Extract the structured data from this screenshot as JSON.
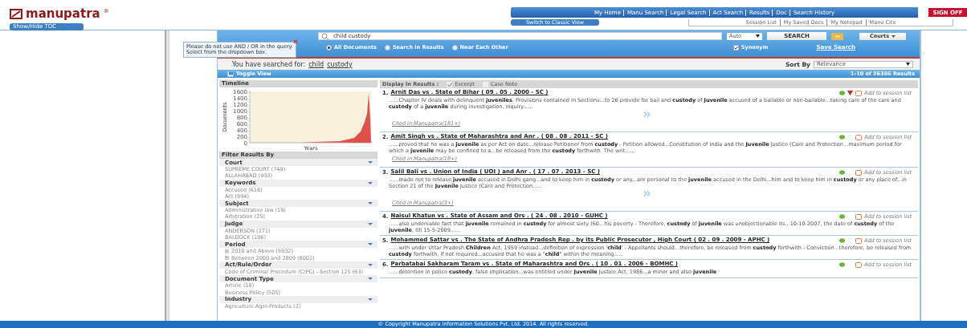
{
  "logo": {
    "text": "manupatra",
    "mark": "®"
  },
  "toc_button": "Show/Hide TOC",
  "nav": [
    "My Home",
    "Manu Search",
    "Legal Search",
    "Act Search",
    "Results",
    "Doc",
    "Search History"
  ],
  "sign_off": "SIGN OFF",
  "classic_view": "Switch to Classic View",
  "user_links": [
    "Session List",
    "My Saved Docs",
    "My Notepad",
    "Manu Cite"
  ],
  "tooltip": "Please do not use AND / OR in the query. Select from the dropdown box.",
  "search": {
    "value": "child custody",
    "mode": "Auto",
    "button": "SEARCH",
    "courts": "Courts"
  },
  "scopes": [
    {
      "label": "All Documents",
      "selected": true
    },
    {
      "label": "Search in Results",
      "selected": false
    },
    {
      "label": "Near Each Other",
      "selected": false
    }
  ],
  "synonym": {
    "label": "Synonym",
    "checked": true
  },
  "save_search": "Save Search",
  "searched": {
    "label": "You have searched for:",
    "terms": [
      "child",
      "custody"
    ]
  },
  "sort": {
    "label": "Sort By",
    "value": "Relevance"
  },
  "toggle_view": "Toggle View",
  "result_count": "1-10 of 26386 Results",
  "timeline": {
    "title": "Timeline",
    "ylabel": "Documents",
    "xlabel": "Years",
    "yticks": [
      "1600",
      "1400",
      "1200",
      "1000",
      "800",
      "600",
      "400",
      "200",
      "0"
    ]
  },
  "filters": {
    "title": "Filter Results By",
    "groups": [
      {
        "name": "Court",
        "items": [
          {
            "label": "SUPREME COURT (749)",
            "kind": "plain"
          },
          {
            "label": "ALLAHABAD (933)",
            "kind": "plain"
          }
        ]
      },
      {
        "name": "Keywords",
        "items": [
          {
            "label": "Accused (616)",
            "kind": "plain"
          },
          {
            "label": "Act (994)",
            "kind": "plain"
          }
        ]
      },
      {
        "name": "Subject",
        "items": [
          {
            "label": "Administrative law (19)",
            "kind": "plain"
          },
          {
            "label": "Arbitration (25)",
            "kind": "plain"
          }
        ]
      },
      {
        "name": "Judge",
        "items": [
          {
            "label": "ANDERSON (271)",
            "kind": "plain"
          },
          {
            "label": "BALDOCK (106)",
            "kind": "plain"
          }
        ]
      },
      {
        "name": "Period",
        "items": [
          {
            "label": "2010 and Above (5932)",
            "kind": "expandable"
          },
          {
            "label": "Between 2000 and 2009 (8002)",
            "kind": "expandable"
          }
        ]
      },
      {
        "name": "Act/Rule/Order",
        "items": [
          {
            "label": "Code of Criminal Procedure (CrPC) - Section 125 (63)",
            "kind": "plain"
          }
        ]
      },
      {
        "name": "Document Type",
        "items": [
          {
            "label": "Article (18)",
            "kind": "plain"
          },
          {
            "label": "Business Policy (505)",
            "kind": "plain"
          }
        ]
      },
      {
        "name": "Industry",
        "items": [
          {
            "label": "Agriculture Agro Products (2)",
            "kind": "plain"
          }
        ]
      }
    ]
  },
  "display": {
    "label": "Display in Results :",
    "options": [
      {
        "label": "Excerpt",
        "checked": true
      },
      {
        "label": "Case Note",
        "checked": false
      }
    ]
  },
  "results": [
    {
      "number": "1.",
      "title": "Arnit Das vs . State of Bihar ( 09 . 05 . 2000 - SC )",
      "flagged": true,
      "session": "Add to session list",
      "excerpt": "......Chapter IV deals with delinquent **juveniles**. Provisions contained In Sections...to 26 provide for bail and **custody** of **Juvenile** accused of a bailable or non-bailable...taking care of the care and **custody** of a **juvenile** during investigation, inquiry......",
      "more": true,
      "cited": "Cited in Manupatra(181+)"
    },
    {
      "number": "2.",
      "title": "Amit Singh vs . State of Maharashtra and Anr . ( 08 . 08 . 2011 - SC )",
      "flagged": false,
      "session": "Add to session list",
      "excerpt": "......proved that he was a **juvenile** as per Act on date...release Petitioner from **custody** - Petition allowed...Constitution of India and the **Juvenile** Justice (Care and Protection...maximum period for which a **juvenile** may be confined to a...be released from the **custody** forthwith. The writ......",
      "more": false,
      "cited": "Cited in Manupatra(18+)"
    },
    {
      "number": "3.",
      "title": "Salil Bali vs . Union of India ( UOI ) and Anr . ( 17 . 07 . 2013 - SC )",
      "flagged": false,
      "session": "Add to session list",
      "excerpt": "......made not to release **juvenile** accused in Delhi gang...and to keep him in **custody** or any...are personal to the **juvenile** accused in the Delhi...him and to keep him in **custody** or any place of...in Section 21 of the **Juvenile** Justice (Care and Protection......",
      "more": true,
      "cited": "Cited in Manupatra(3+)"
    },
    {
      "number": "4.",
      "title": "Naisul Khatun vs . State of Assam and Ors . ( 24 . 08 . 2010 - GUHC )",
      "flagged": false,
      "session": "Add to session list",
      "excerpt": "......also undeniable fact that **juvenile** remained in **custody** for almost sixty (60...his poverty - Therefore, **custody** of **juvenile** was unobjectionable its...10-10-2007, the date of **custody** of the **juvenile**, till 15-5-2009......",
      "more": false
    },
    {
      "number": "5.",
      "title": "Mohammed Sattar vs . The State of Andhra Pradesh Rep . by its Public Prosecutor , High Court ( 02 . 09 . 2009 - APHC )",
      "flagged": false,
      "session": "Add to session list",
      "excerpt": "......with under Uttar Pradesh **Children** Act, 1959 instead...definition of expression '**child**' - Appellants should...therefore, be released from **custody** forthwith - Conviction...therefore, be released from **custody** forthwith, if not required...accused that he was a \"**child**\" within the meaning......",
      "more": false
    },
    {
      "number": "6.",
      "title": "Parbatabai Sakharam Taram vs . State of Maharashtra and Ors . ( 10 . 01 . 2006 - BOMHC )",
      "flagged": false,
      "session": "Add to session list",
      "excerpt": "......detention in police **custody**, false implication...was entitled under **Juvenile** Justice Act, 1986...a minor and also **juvenile**",
      "more": false
    }
  ],
  "footer": "© Copyright Manupatra Information Solutions Pvt. Ltd. 2014. All rights reserved."
}
